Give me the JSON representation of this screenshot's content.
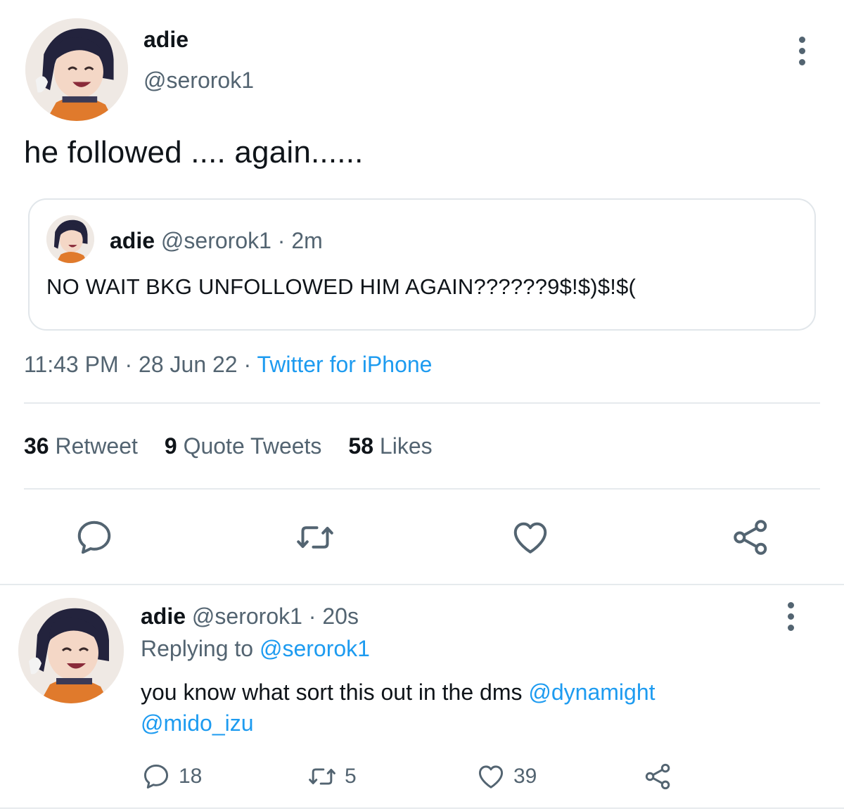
{
  "main_tweet": {
    "author_name": "adie",
    "author_handle": "@serorok1",
    "text": "he followed .... again......",
    "quote": {
      "author_name": "adie",
      "meta": "@serorok1 · 2m",
      "text": "NO WAIT BKG UNFOLLOWED HIM AGAIN??????9$!$)$!$("
    },
    "time": "11:43 PM · 28 Jun 22 · ",
    "source": "Twitter for iPhone",
    "stats": [
      {
        "count": "36",
        "label": "Retweet"
      },
      {
        "count": "9",
        "label": "Quote Tweets"
      },
      {
        "count": "58",
        "label": "Likes"
      }
    ],
    "actions": [
      "reply-icon",
      "retweet-icon",
      "like-icon",
      "share-icon"
    ]
  },
  "reply_tweet": {
    "author_name": "adie",
    "meta": "@serorok1 · 20s",
    "replying_prefix": "Replying to ",
    "replying_to": "@serorok1",
    "text": "you know what sort this out in the dms ",
    "mention_1": "@dynamight",
    "mention_2": "@mido_izu",
    "counts": {
      "replies": "18",
      "retweets": "5",
      "likes": "39"
    }
  },
  "colors": {
    "text": "#0f1419",
    "secondary": "#536471",
    "link": "#1d9bf0",
    "border": "#e1e6ea"
  }
}
